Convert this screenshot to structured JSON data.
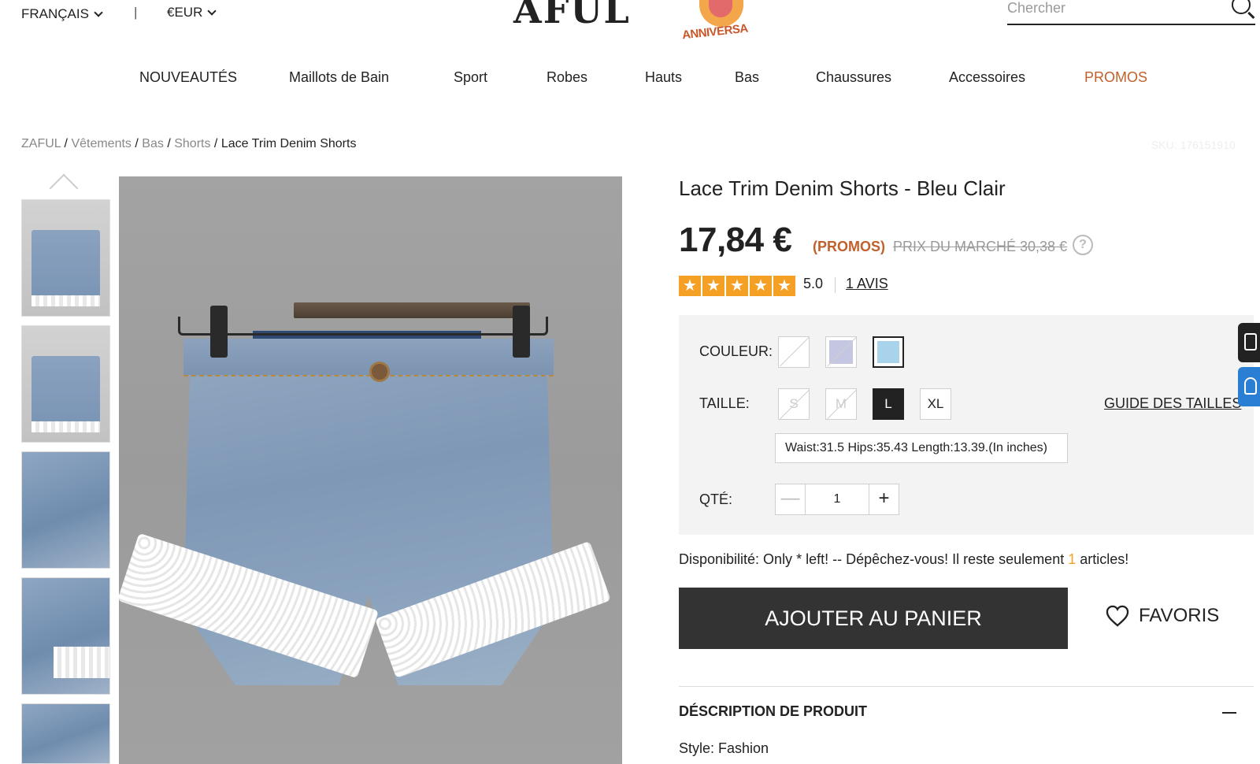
{
  "header": {
    "language": "FRANÇAIS",
    "separator": "|",
    "currency": "€EUR",
    "logo": "AFUL",
    "anniversary_badge": "ANNIVERSA",
    "search_placeholder": "Chercher"
  },
  "nav": {
    "items": [
      "NOUVEAUTÉS",
      "Maillots de Bain",
      "Sport",
      "Robes",
      "Hauts",
      "Bas",
      "Chaussures",
      "Accessoires",
      "PROMOS"
    ]
  },
  "breadcrumb": {
    "items": [
      "ZAFUL",
      "Vêtements",
      "Bas",
      "Shorts",
      "Lace Trim Denim Shorts"
    ],
    "separator": "/"
  },
  "sku": "SKU: 176151910",
  "product": {
    "title": "Lace Trim Denim Shorts - Bleu Clair",
    "price": "17,84 €",
    "promo_label": "(PROMOS)",
    "market_price": "PRIX DU MARCHÉ 30,38 €",
    "help": "?",
    "stars": "★",
    "rating": "5.0",
    "reviews": "1 AVIS",
    "color_label": "COULEUR:",
    "colors": [
      {
        "name": "white",
        "hex": "#ffffff",
        "available": false
      },
      {
        "name": "lavender",
        "hex": "#c4c6e2",
        "available": false
      },
      {
        "name": "light-blue",
        "hex": "#a9d3ea",
        "available": true,
        "selected": true
      }
    ],
    "size_label": "TAILLE:",
    "sizes": [
      {
        "label": "S",
        "available": false
      },
      {
        "label": "M",
        "available": false
      },
      {
        "label": "L",
        "available": true,
        "selected": true
      },
      {
        "label": "XL",
        "available": true
      }
    ],
    "size_guide": "GUIDE DES TAILLES",
    "measurements": "Waist:31.5   Hips:35.43   Length:13.39.(In inches)",
    "qty_label": "QTÉ:",
    "qty_minus": "—",
    "qty_value": "1",
    "qty_plus": "+",
    "availability_prefix": "Disponibilité: Only * left! -- Dépêchez-vous! Il reste seulement",
    "availability_count": "1",
    "availability_suffix": "articles!",
    "add_to_cart": "AJOUTER AU PANIER",
    "favorites": "FAVORIS",
    "description_title": "DÉSCRIPTION DE PRODUIT",
    "style": "Style: Fashion"
  },
  "colors": {
    "accent": "#c0612b",
    "star": "#f4a024",
    "cart_button": "#333333",
    "options_bg": "#f3f3f3"
  }
}
